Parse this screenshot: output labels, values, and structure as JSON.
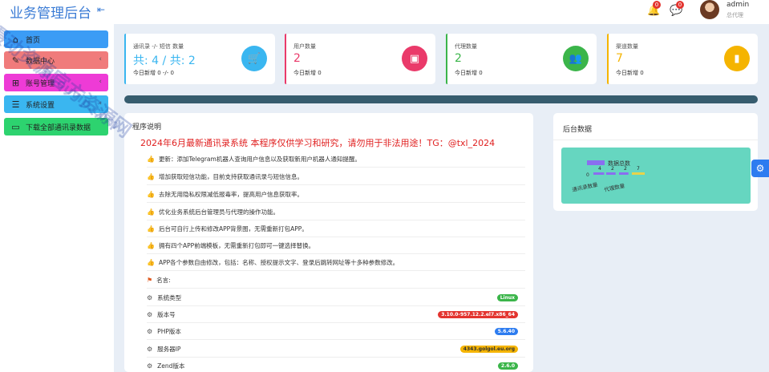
{
  "brand": {
    "title": "业务管理后台",
    "collapse_icon": "collapse-left-icon"
  },
  "sidebar": {
    "items": [
      {
        "label": "首页",
        "icon": "home-icon",
        "color": "#3b9cf5"
      },
      {
        "label": "数据中心",
        "icon": "edit-icon",
        "color": "#f07b7b",
        "chevron": "‹"
      },
      {
        "label": "账号管理",
        "icon": "grid-icon",
        "color": "#ee3bd6",
        "chevron": "‹"
      },
      {
        "label": "系统设置",
        "icon": "menu-icon",
        "color": "#3ab6f0",
        "chevron": "‹"
      },
      {
        "label": "下载全部通讯录数据",
        "icon": "folder-icon",
        "color": "#2dd36f"
      }
    ]
  },
  "header": {
    "bell_count": "0",
    "msg_count": "0",
    "username": "admin",
    "role": "总代理"
  },
  "stats": [
    {
      "label": "通讯录 -/- 短信 数量",
      "value": "共: 4 / 共: 2",
      "sub": "今日新增 0 -/- 0",
      "color": "#3ab6f0",
      "icon": "cart-icon",
      "icon_glyph": "🛒"
    },
    {
      "label": "用户数量",
      "value": "2",
      "sub": "今日新增 0",
      "color": "#ea3a6a",
      "icon": "wallet-icon",
      "icon_glyph": "▣"
    },
    {
      "label": "代理数量",
      "value": "2",
      "sub": "今日新增 0",
      "color": "#3bb54a",
      "icon": "users-icon",
      "icon_glyph": "👥"
    },
    {
      "label": "渠道数量",
      "value": "7",
      "sub": "今日新增 0",
      "color": "#f5b400",
      "icon": "bar-chart-icon",
      "icon_glyph": "▮"
    }
  ],
  "panel": {
    "title": "程序说明",
    "headline": "2024年6月最新通讯录系统 本程序仅供学习和研究，请勿用于非法用途！TG：@txl_2024",
    "notes": [
      "更新：添加Telegram机器人查询用户信息以及获取新用户机器人通知提醒。",
      "增加获取短信功能，目前支持获取通讯录与短信信息。",
      "去除无用隐私权限减低报毒率，提高用户信息获取率。",
      "优化业务系统后台管理员与代理的操作功能。",
      "后台可自行上传和修改APP背景图，无需重新打包APP。",
      "拥有四个APP前端模板，无需重新打包即可一键选择替换。",
      "APP各个参数自由修改，包括：名称、授权提示文字、登录后跳转网址等十多种参数修改。"
    ],
    "motto_label": "名言:",
    "sysinfo": [
      {
        "label": "系统类型",
        "value": "Linux",
        "color": "#3bb54a"
      },
      {
        "label": "版本号",
        "value": "3.10.0-957.12.2.el7.x86_64",
        "color": "#e3342f"
      },
      {
        "label": "PHP版本",
        "value": "5.6.40",
        "color": "#2d7cf0"
      },
      {
        "label": "服务器IP",
        "value": "4343.golgol.eu.org",
        "color": "#f5b400"
      },
      {
        "label": "Zend版本",
        "value": "2.6.0",
        "color": "#3bb54a"
      }
    ]
  },
  "right_panel": {
    "title": "后台数据",
    "chart_data": {
      "type": "bar",
      "title": "",
      "legend": "数据总数",
      "categories": [
        "通讯录数量",
        "代理数量"
      ],
      "values": [
        4,
        2,
        2,
        7
      ],
      "value_labels": [
        "4",
        "2",
        "2",
        "7"
      ],
      "zero_label": "0"
    }
  },
  "watermark": {
    "line1": "摄动资源官方资源网",
    "line2": "bi.ouvip.com"
  }
}
